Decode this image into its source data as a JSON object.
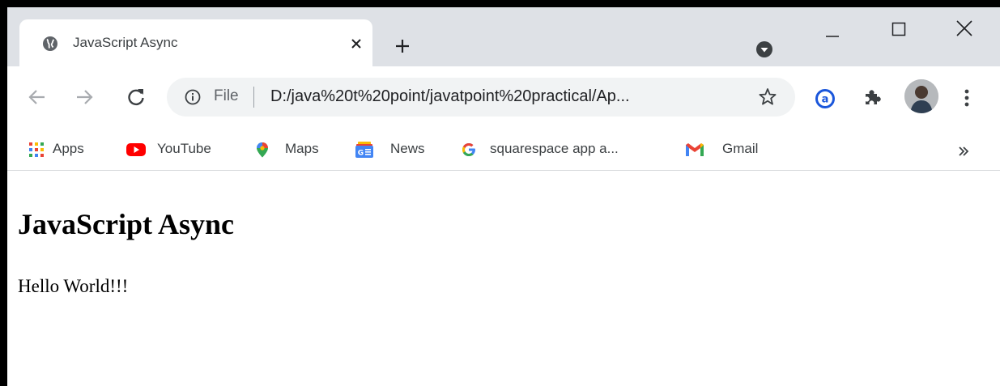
{
  "tab": {
    "title": "JavaScript Async",
    "favicon_icon": "globe-icon",
    "close_icon": "close-icon"
  },
  "tabstrip": {
    "new_tab_icon": "plus-icon",
    "tab_search_icon": "chevron-down-circle-icon"
  },
  "window_controls": {
    "minimize_icon": "minimize-icon",
    "maximize_icon": "maximize-icon",
    "close_icon": "close-icon"
  },
  "toolbar": {
    "back_icon": "arrow-left-icon",
    "forward_icon": "arrow-right-icon",
    "reload_icon": "reload-icon",
    "omnibox": {
      "scheme_label": "File",
      "url": "D:/java%20t%20point/javatpoint%20practical/Ap...",
      "info_icon": "info-icon",
      "bookmark_icon": "star-icon"
    },
    "extension_icon": "a-circle-icon",
    "extensions_icon": "puzzle-icon",
    "menu_icon": "vertical-dots-icon"
  },
  "bookmarks": {
    "items": [
      {
        "label": "Apps",
        "icon": "apps-grid-icon"
      },
      {
        "label": "YouTube",
        "icon": "youtube-icon"
      },
      {
        "label": "Maps",
        "icon": "map-pin-icon"
      },
      {
        "label": "News",
        "icon": "google-news-icon"
      },
      {
        "label": "squarespace app a...",
        "icon": "google-g-icon"
      },
      {
        "label": "Gmail",
        "icon": "gmail-icon"
      }
    ],
    "more_icon": "double-chevron-right-icon"
  },
  "page": {
    "heading": "JavaScript Async",
    "text": "Hello World!!!"
  },
  "colors": {
    "tabstrip_bg": "#dee1e6",
    "omnibox_bg": "#f1f3f4",
    "window_border": "#000000"
  }
}
